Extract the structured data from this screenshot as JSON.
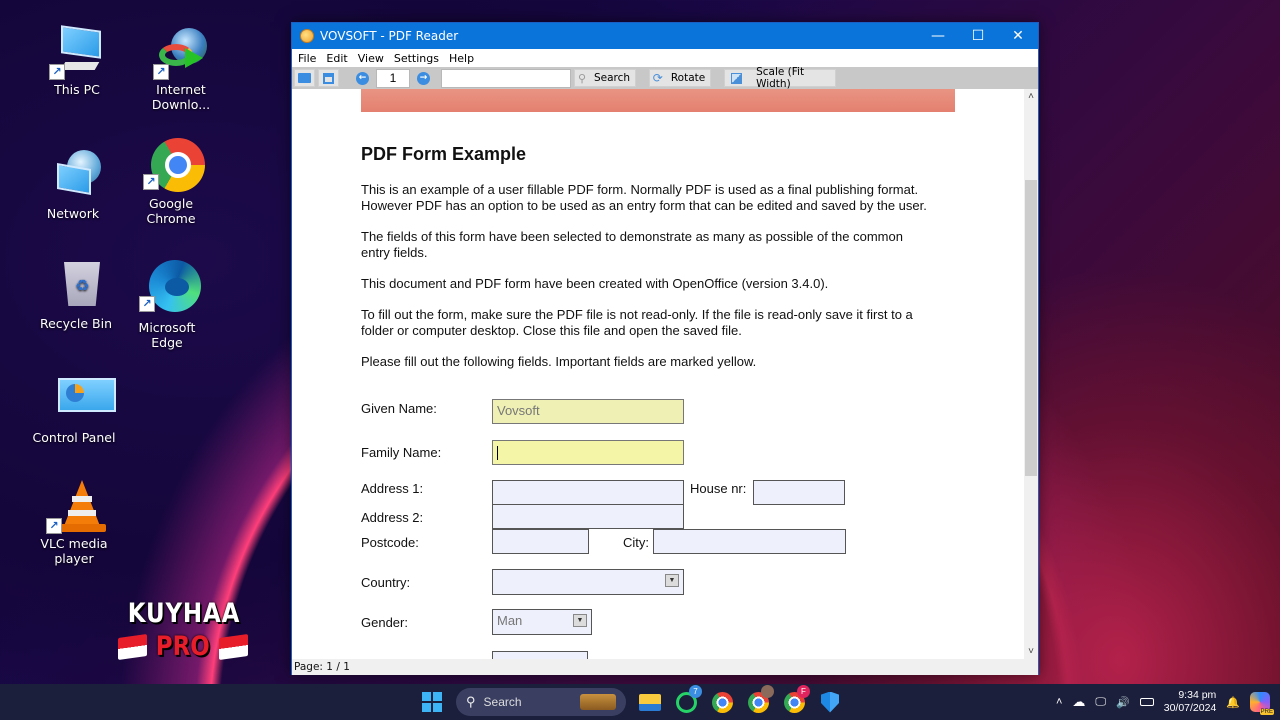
{
  "desktop": {
    "icons": [
      {
        "label": "This PC",
        "icon": "computer-icon"
      },
      {
        "label": "Internet Downlo...",
        "icon": "internet-download-manager-icon"
      },
      {
        "label": "Network",
        "icon": "network-icon"
      },
      {
        "label": "Google Chrome",
        "icon": "chrome-icon"
      },
      {
        "label": "Recycle Bin",
        "icon": "recycle-bin-icon"
      },
      {
        "label": "Microsoft Edge",
        "icon": "edge-icon"
      },
      {
        "label": "Control Panel",
        "icon": "control-panel-icon"
      },
      {
        "label": "VLC media player",
        "icon": "vlc-icon"
      }
    ],
    "watermark": {
      "line1": "KUYHAA",
      "line2": "PRO"
    }
  },
  "window": {
    "title": "VOVSOFT - PDF Reader",
    "controls": {
      "minimize": "—",
      "maximize": "☐",
      "close": "✕"
    },
    "menu": [
      "File",
      "Edit",
      "View",
      "Settings",
      "Help"
    ],
    "toolbar": {
      "page_number": "1",
      "search_value": "",
      "search_label": "Search",
      "rotate_label": "Rotate",
      "scale_label": "Scale (Fit Width)"
    },
    "status": "Page: 1 / 1",
    "scroll_position_fraction": 0.18
  },
  "document": {
    "title": "PDF Form Example",
    "paragraphs": [
      "This is an example of a user fillable PDF form. Normally PDF is used as a final publishing format. However PDF has an option to be used as an entry form that can be edited and saved by the user.",
      "The fields of this form have been selected to demonstrate as many as possible of the common entry fields.",
      "This document and PDF form have been created with OpenOffice (version 3.4.0).",
      "To fill out the form, make sure the PDF file is not read-only. If the file is read-only save it first to a folder or computer desktop. Close this file and open the saved file.",
      "Please fill out the following fields. Important fields are marked yellow."
    ],
    "form": {
      "given_name": {
        "label": "Given Name:",
        "value": "Vovsoft"
      },
      "family_name": {
        "label": "Family Name:",
        "value": ""
      },
      "address1": {
        "label": "Address 1:",
        "value": ""
      },
      "house_nr": {
        "label": "House nr:",
        "value": ""
      },
      "address2": {
        "label": "Address 2:",
        "value": ""
      },
      "postcode": {
        "label": "Postcode:",
        "value": ""
      },
      "city": {
        "label": "City:",
        "value": ""
      },
      "country": {
        "label": "Country:",
        "value": ""
      },
      "gender": {
        "label": "Gender:",
        "value": "Man"
      }
    }
  },
  "taskbar": {
    "search_label": "Search",
    "whatsapp_badge": "7",
    "chrome_profile_badge": "F",
    "time": "9:34 pm",
    "date": "30/07/2024",
    "copilot_badge": "PRE"
  }
}
